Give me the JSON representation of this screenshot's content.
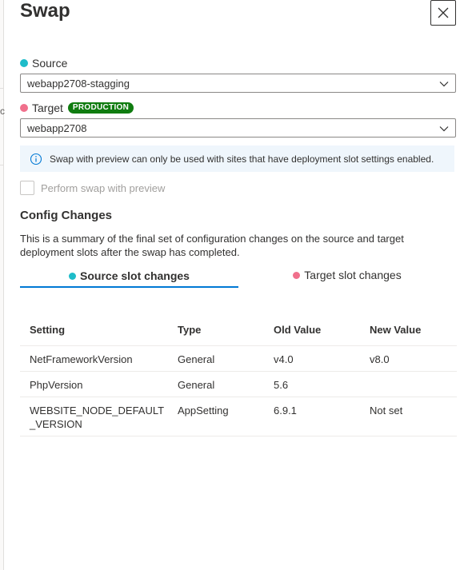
{
  "panel": {
    "title": "Swap"
  },
  "background_peek": "c",
  "source": {
    "label": "Source",
    "value": "webapp2708-stagging"
  },
  "target": {
    "label": "Target",
    "badge": "PRODUCTION",
    "value": "webapp2708"
  },
  "info": {
    "text": "Swap with preview can only be used with sites that have deployment slot settings enabled."
  },
  "preview_checkbox": {
    "label": "Perform swap with preview"
  },
  "config_changes": {
    "title": "Config Changes",
    "description": "This is a summary of the final set of configuration changes on the source and target deployment slots after the swap has completed.",
    "tabs": [
      {
        "label": "Source slot changes"
      },
      {
        "label": "Target slot changes"
      }
    ],
    "table": {
      "columns": [
        "Setting",
        "Type",
        "Old Value",
        "New Value"
      ],
      "rows": [
        [
          "NetFrameworkVersion",
          "General",
          "v4.0",
          "v8.0"
        ],
        [
          "PhpVersion",
          "General",
          "5.6",
          ""
        ],
        [
          "WEBSITE_NODE_DEFAULT_VERSION",
          "AppSetting",
          "6.9.1",
          "Not set"
        ]
      ]
    }
  },
  "colors": {
    "source_dot": "#1ebcc9",
    "target_dot": "#f0708c",
    "badge_bg": "#107c10",
    "tab_underline": "#0078d4",
    "info_bg": "#eff6fc"
  }
}
